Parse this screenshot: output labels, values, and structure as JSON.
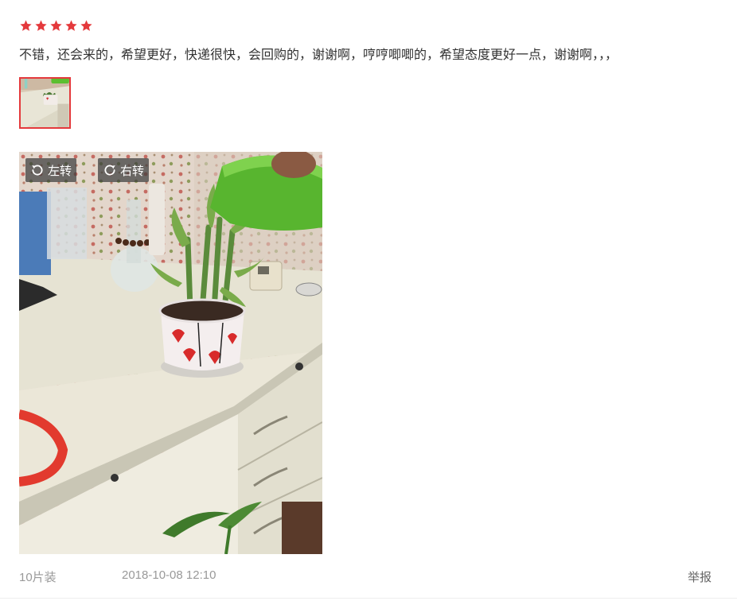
{
  "rating": {
    "stars": 5,
    "max": 5,
    "star_color": "#e4393c",
    "icon": "star-icon"
  },
  "review": {
    "text": "不错，还会来的，希望更好，快递很快，会回购的，谢谢啊，哼哼唧唧的，希望态度更好一点，谢谢啊，，，"
  },
  "gallery": {
    "selected_border_color": "#e4393c",
    "rotate_left_label": "左转",
    "rotate_right_label": "右转",
    "rotate_left_icon": "rotate-left-icon",
    "rotate_right_icon": "rotate-right-icon"
  },
  "footer": {
    "spec": "10片装",
    "date": "2018-10-08 12:10",
    "report_label": "举报"
  }
}
